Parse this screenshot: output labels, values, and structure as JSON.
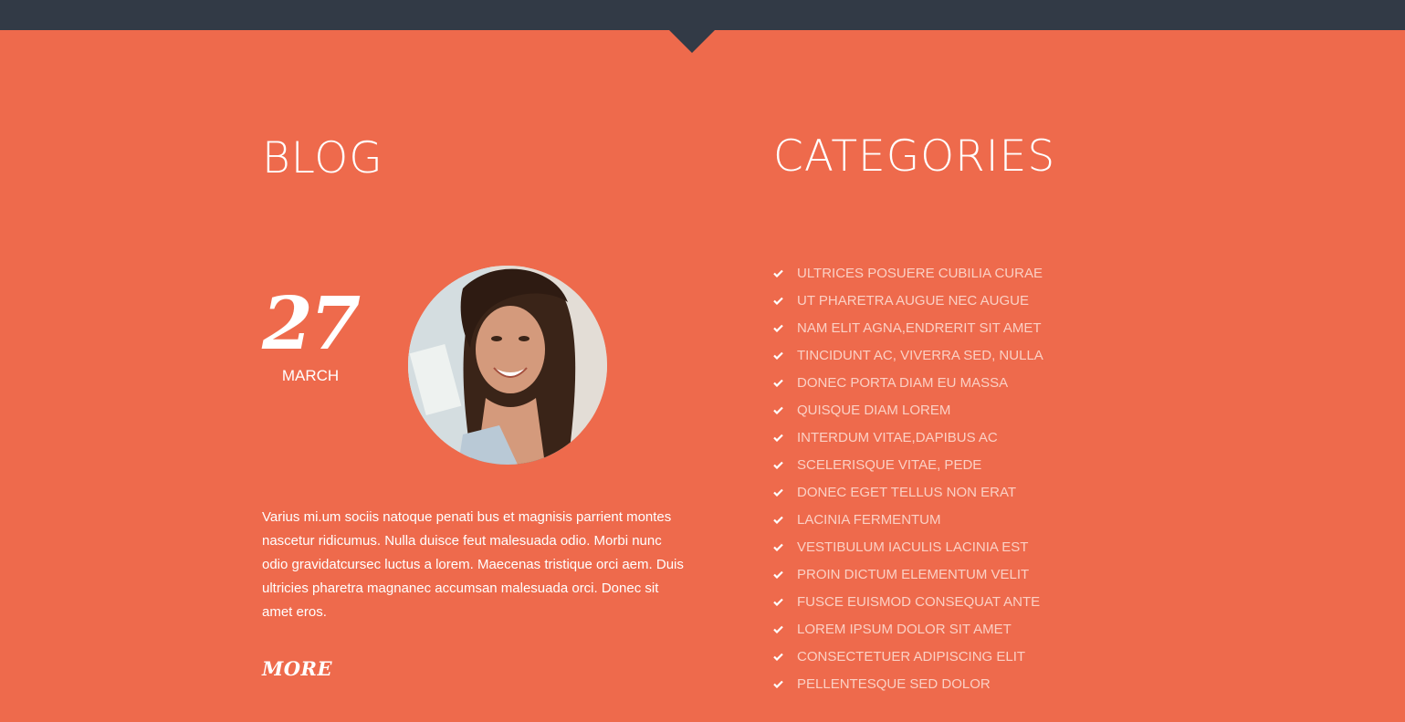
{
  "blog": {
    "title": "BLOG",
    "post": {
      "day": "27",
      "month": "MARCH",
      "text": "Varius mi.um sociis natoque penati bus et magnisis parrient montes nascetur ridicumus. Nulla duisce feut malesuada odio. Morbi nunc odio gravidatcursec luctus a lorem. Maecenas tristique orci aem. Duis ultricies pharetra magnanec accumsan malesuada orci. Donec sit amet eros.",
      "more_label": "MORE"
    }
  },
  "categories": {
    "title": "CATEGORIES",
    "items": [
      "ULTRICES POSUERE CUBILIA CURAE",
      "UT PHARETRA AUGUE NEC AUGUE",
      "NAM ELIT AGNA,ENDRERIT SIT AMET",
      "TINCIDUNT AC, VIVERRA SED, NULLA",
      "DONEC PORTA DIAM EU MASSA",
      "QUISQUE DIAM LOREM",
      "INTERDUM VITAE,DAPIBUS AC",
      "SCELERISQUE VITAE, PEDE",
      "DONEC EGET TELLUS NON ERAT",
      "LACINIA FERMENTUM",
      "VESTIBULUM IACULIS LACINIA EST",
      "PROIN DICTUM ELEMENTUM VELIT",
      "FUSCE EUISMOD CONSEQUAT ANTE",
      "LOREM IPSUM DOLOR SIT AMET",
      "CONSECTETUER ADIPISCING ELIT",
      "PELLENTESQUE SED DOLOR"
    ]
  },
  "colors": {
    "background": "#ee6a4c",
    "topbar": "#323a46",
    "category_link": "#fbd0c4"
  },
  "icons": {
    "category_bullet": "check-icon"
  }
}
